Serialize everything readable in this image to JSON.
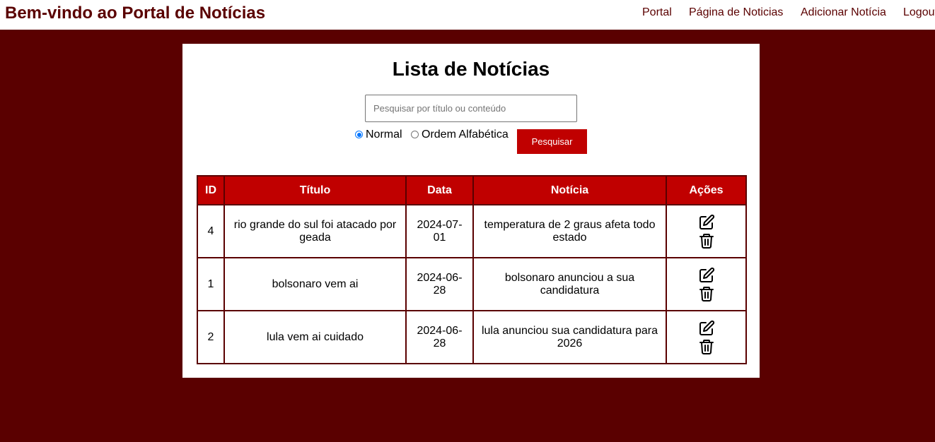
{
  "header": {
    "brand": "Bem-vindo ao Portal de Notícias",
    "nav": [
      {
        "label": "Portal"
      },
      {
        "label": "Página de Noticias"
      },
      {
        "label": "Adicionar Notícia"
      },
      {
        "label": "Logout"
      }
    ]
  },
  "main": {
    "title": "Lista de Notícias",
    "search": {
      "placeholder": "Pesquisar por título ou conteúdo",
      "value": ""
    },
    "sort": {
      "options": [
        {
          "label": "Normal",
          "checked": true
        },
        {
          "label": "Ordem Alfabética",
          "checked": false
        }
      ]
    },
    "search_button": "Pesquisar",
    "table": {
      "columns": [
        "ID",
        "Título",
        "Data",
        "Notícia",
        "Ações"
      ],
      "rows": [
        {
          "id": "4",
          "titulo": "rio grande do sul foi atacado por geada",
          "data": "2024-07-01",
          "noticia": "temperatura de 2 graus afeta todo estado"
        },
        {
          "id": "1",
          "titulo": "bolsonaro vem ai",
          "data": "2024-06-28",
          "noticia": "bolsonaro anunciou a sua candidatura"
        },
        {
          "id": "2",
          "titulo": "lula vem ai cuidado",
          "data": "2024-06-28",
          "noticia": "lula anunciou sua candidatura para 2026"
        }
      ],
      "action_icons": [
        "edit-icon",
        "trash-icon"
      ]
    }
  },
  "colors": {
    "background": "#5a0000",
    "accent": "#c00000",
    "radio": "#0075ff"
  }
}
